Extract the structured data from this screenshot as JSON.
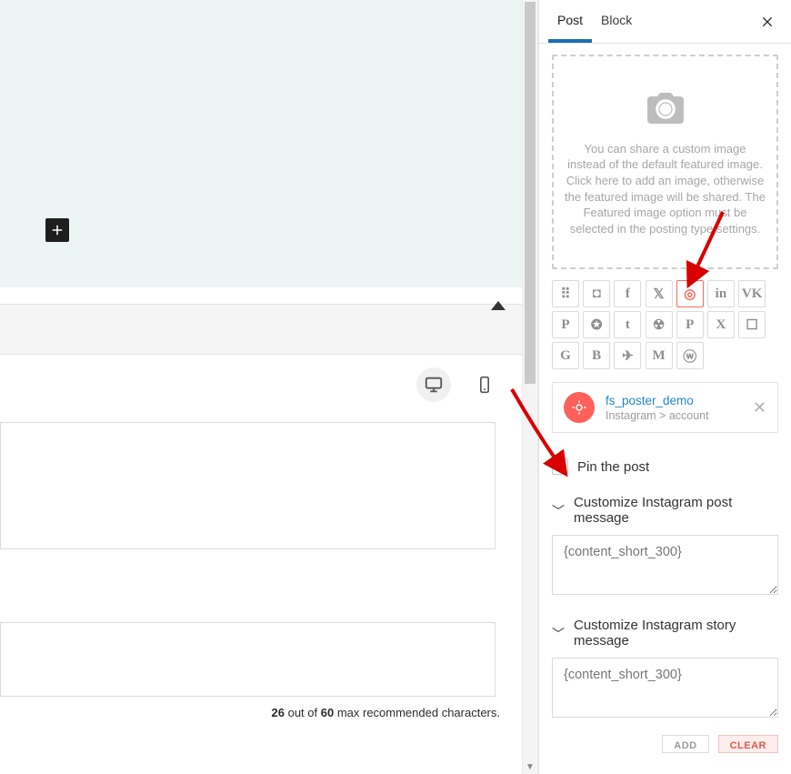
{
  "sidebar": {
    "tabs": {
      "post": "Post",
      "block": "Block"
    },
    "image_hint": "You can share a custom image instead of the default featured image. Click here to add an image, otherwise the featured image will be shared. The Featured image option must be selected in the posting type settings.",
    "pin_label": "Pin the post",
    "section_post": "Customize Instagram post message",
    "section_story": "Customize Instagram story message",
    "msg_post": "{content_short_300}",
    "msg_story": "{content_short_300}",
    "btn_add": "ADD",
    "btn_clear": "CLEAR",
    "account": {
      "name": "fs_poster_demo",
      "sub": "Instagram > account"
    }
  },
  "editor": {
    "seo": {
      "count": "26",
      "mid": " out of ",
      "max": "60",
      "tail": " max recommended characters."
    }
  },
  "social": [
    {
      "name": "grid-icon",
      "g": "⠿"
    },
    {
      "name": "crop-icon",
      "g": "◘"
    },
    {
      "name": "facebook-icon",
      "g": "f"
    },
    {
      "name": "twitter-icon",
      "g": "𝕏"
    },
    {
      "name": "instagram-icon",
      "g": "◎",
      "sel": true
    },
    {
      "name": "linkedin-icon",
      "g": "in"
    },
    {
      "name": "vk-icon",
      "g": "VK"
    },
    {
      "name": "pinterest-icon",
      "g": "P"
    },
    {
      "name": "reddit-icon",
      "g": "✪"
    },
    {
      "name": "tumblr-icon",
      "g": "t"
    },
    {
      "name": "ok-icon",
      "g": "☢"
    },
    {
      "name": "parking-icon",
      "g": "P"
    },
    {
      "name": "xing-icon",
      "g": "X"
    },
    {
      "name": "discord-icon",
      "g": "☐"
    },
    {
      "name": "google-icon",
      "g": "G"
    },
    {
      "name": "blogger-icon",
      "g": "B"
    },
    {
      "name": "telegram-icon",
      "g": "✈"
    },
    {
      "name": "medium-icon",
      "g": "M"
    },
    {
      "name": "wordpress-icon",
      "g": "ⓦ"
    }
  ]
}
